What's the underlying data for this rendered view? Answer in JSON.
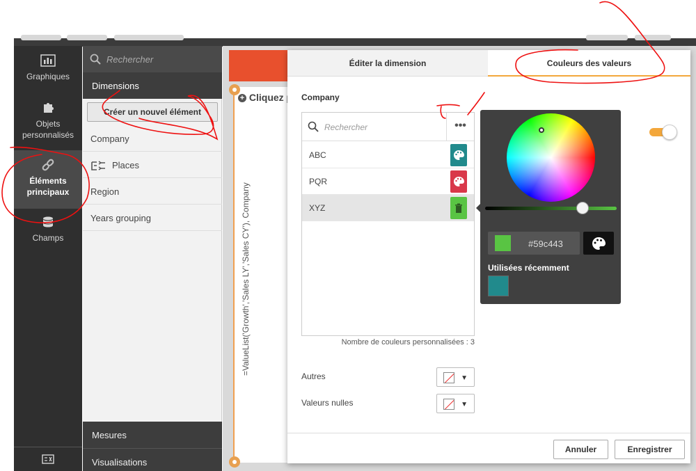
{
  "asset_bar": {
    "items": [
      {
        "label": "Graphiques",
        "icon": "bar-chart-icon"
      },
      {
        "label": "Objets personnalisés",
        "icon": "puzzle-icon"
      },
      {
        "label": "Éléments principaux",
        "icon": "link-icon",
        "active": true
      },
      {
        "label": "Champs",
        "icon": "database-icon"
      }
    ]
  },
  "library": {
    "search_placeholder": "Rechercher",
    "dimensions_header": "Dimensions",
    "create_button": "Créer un nouvel élément",
    "items": [
      "Company",
      "Places",
      "Region",
      "Years grouping"
    ],
    "measures": "Mesures",
    "visualisations": "Visualisations"
  },
  "sheet": {
    "click_hint": "Cliquez p",
    "dimension_expression": "=ValueList('Growth','Sales LY','Sales CY'), Company"
  },
  "dialog": {
    "tab_edit": "Éditer la dimension",
    "tab_colors": "Couleurs des valeurs",
    "field_label": "Company",
    "search_placeholder": "Rechercher",
    "more_label": "•••",
    "values": [
      {
        "label": "ABC",
        "color": "#218a8c",
        "action_icon": "palette-icon"
      },
      {
        "label": "PQR",
        "color": "#d9384a",
        "action_icon": "palette-icon"
      },
      {
        "label": "XYZ",
        "color": "#59c443",
        "action_icon": "trash-icon"
      }
    ],
    "custom_count": "Nombre de couleurs personnalisées : 3",
    "others_label": "Autres",
    "nulls_label": "Valeurs nulles",
    "cancel": "Annuler",
    "save": "Enregistrer"
  },
  "picker": {
    "current_color": "#59c443",
    "hex_value": "#59c443",
    "recent_label": "Utilisées récemment",
    "recent_colors": [
      "#218a8c"
    ]
  }
}
